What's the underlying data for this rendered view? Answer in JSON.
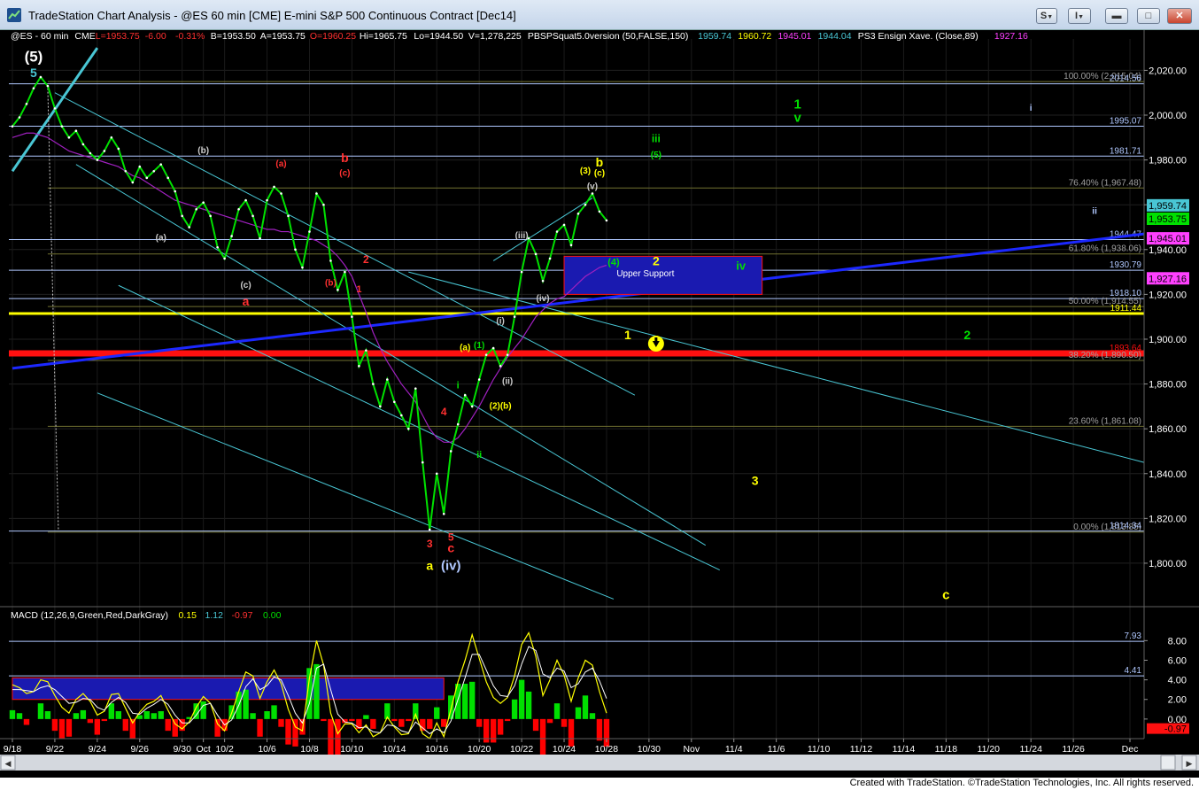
{
  "window": {
    "title": "TradeStation Chart Analysis - @ES 60 min [CME] E-mini S&P 500 Continuous Contract [Dec14]",
    "buttons": {
      "s": "S",
      "i": "I"
    }
  },
  "colors": {
    "price": "#00e000",
    "ma": "#a020c0",
    "channel": "#49c6d4",
    "trend": "#1c28ff",
    "support_line": "#ffff00",
    "resistance_line": "#ff1010",
    "level": "#b0c8ff",
    "fib": "#707030",
    "box": "#1a1ab0",
    "macd_hist_pos": "#00e000",
    "macd_hist_neg": "#ff0000"
  },
  "header": [
    {
      "text": "@ES - 60 min",
      "color": "#ffffff"
    },
    {
      "text": "CME",
      "color": "#ffffff"
    },
    {
      "text": "L=1953.75",
      "color": "#ff3030"
    },
    {
      "text": "-6.00",
      "color": "#ff3030"
    },
    {
      "text": "-0.31%",
      "color": "#ff3030"
    },
    {
      "text": "B=1953.50",
      "color": "#ffffff"
    },
    {
      "text": "A=1953.75",
      "color": "#ffffff"
    },
    {
      "text": "O=1960.25",
      "color": "#ff3030"
    },
    {
      "text": "Hi=1965.75",
      "color": "#ffffff"
    },
    {
      "text": "Lo=1944.50",
      "color": "#ffffff"
    },
    {
      "text": "V=1,278,225",
      "color": "#ffffff"
    },
    {
      "text": "PBSPSquat5.0version (50,FALSE,150)",
      "color": "#ffffff"
    },
    {
      "text": "1959.74",
      "color": "#49c6d4"
    },
    {
      "text": "1960.72",
      "color": "#ffff00"
    },
    {
      "text": "1945.01",
      "color": "#ff40ff"
    },
    {
      "text": "1944.04",
      "color": "#49c6d4"
    },
    {
      "text": "PS3 Ensign Xave. (Close,89)",
      "color": "#ffffff"
    },
    {
      "text": "1927.16",
      "color": "#ff40ff"
    }
  ],
  "chart_data": {
    "type": "line",
    "title": "@ES - 60 min",
    "y_ticks": [
      "2,020.00",
      "2,000.00",
      "1,980.00",
      "1,960.00",
      "1,940.00",
      "1,920.00",
      "1,900.00",
      "1,880.00",
      "1,860.00",
      "1,840.00",
      "1,820.00",
      "1,800.00"
    ],
    "y_tick_values": [
      2020,
      2000,
      1980,
      1960,
      1940,
      1920,
      1900,
      1880,
      1860,
      1840,
      1820,
      1800
    ],
    "ylim": [
      1781,
      2034
    ],
    "x_ticks": [
      {
        "label": "9/18",
        "i": 0
      },
      {
        "label": "9/22",
        "i": 6
      },
      {
        "label": "9/24",
        "i": 12
      },
      {
        "label": "9/26",
        "i": 18
      },
      {
        "label": "9/30",
        "i": 24
      },
      {
        "label": "Oct",
        "i": 27
      },
      {
        "label": "10/2",
        "i": 30
      },
      {
        "label": "10/6",
        "i": 36
      },
      {
        "label": "10/8",
        "i": 42
      },
      {
        "label": "10/10",
        "i": 48
      },
      {
        "label": "10/14",
        "i": 54
      },
      {
        "label": "10/16",
        "i": 60
      },
      {
        "label": "10/20",
        "i": 66
      },
      {
        "label": "10/22",
        "i": 72
      },
      {
        "label": "10/24",
        "i": 78
      },
      {
        "label": "10/28",
        "i": 84
      },
      {
        "label": "10/30",
        "i": 90
      },
      {
        "label": "Nov",
        "i": 96
      },
      {
        "label": "11/4",
        "i": 102
      },
      {
        "label": "11/6",
        "i": 108
      },
      {
        "label": "11/10",
        "i": 114
      },
      {
        "label": "11/12",
        "i": 120
      },
      {
        "label": "11/14",
        "i": 126
      },
      {
        "label": "11/18",
        "i": 132
      },
      {
        "label": "11/20",
        "i": 138
      },
      {
        "label": "11/24",
        "i": 144
      },
      {
        "label": "11/26",
        "i": 150
      },
      {
        "label": "Dec",
        "i": 158
      }
    ],
    "x_range": [
      -0.5,
      160
    ],
    "series": [
      {
        "values": [
          1995,
          1999,
          2005,
          2012,
          2017,
          2013,
          2003,
          1995,
          1990,
          1993,
          1987,
          1983,
          1980,
          1984,
          1990,
          1985,
          1975,
          1970,
          1977,
          1972,
          1975,
          1978,
          1972,
          1966,
          1955,
          1950,
          1958,
          1961,
          1955,
          1941,
          1936,
          1946,
          1958,
          1962,
          1955,
          1945,
          1962,
          1968,
          1965,
          1955,
          1940,
          1932,
          1948,
          1965,
          1960,
          1935,
          1922,
          1930,
          1910,
          1888,
          1895,
          1880,
          1870,
          1882,
          1872,
          1866,
          1860,
          1878,
          1845,
          1815,
          1840,
          1822,
          1850,
          1862,
          1875,
          1870,
          1882,
          1893,
          1896,
          1888,
          1893,
          1910,
          1930,
          1945,
          1938,
          1926,
          1936,
          1948,
          1951,
          1942,
          1956,
          1960,
          1965,
          1957,
          1953
        ],
        "x_start": 0
      }
    ],
    "ma_values": [
      1990,
      1991,
      1992,
      1992,
      1991,
      1990,
      1988,
      1986,
      1984,
      1983,
      1982,
      1981,
      1980,
      1979,
      1978,
      1977,
      1975,
      1973,
      1972,
      1970,
      1968,
      1966,
      1964,
      1962,
      1961,
      1960,
      1959,
      1958,
      1957,
      1956,
      1955,
      1954,
      1953,
      1952,
      1951,
      1950,
      1949,
      1949,
      1948,
      1948,
      1947,
      1946,
      1945,
      1944,
      1942,
      1940,
      1937,
      1933,
      1928,
      1920,
      1912,
      1903,
      1896,
      1890,
      1885,
      1880,
      1876,
      1872,
      1866,
      1860,
      1856,
      1854,
      1854,
      1856,
      1860,
      1865,
      1870,
      1876,
      1882,
      1887,
      1892,
      1896,
      1900,
      1905,
      1910,
      1913,
      1916,
      1918,
      1919,
      1922,
      1925,
      1928,
      1930,
      1932,
      1933
    ],
    "levels": [
      {
        "label": "100.00% (2,015.04)",
        "value": 2015.0,
        "kind": "fib"
      },
      {
        "label": "2014.56",
        "value": 2014.0,
        "kind": "level"
      },
      {
        "label": "1995.07",
        "value": 1995.07,
        "kind": "level"
      },
      {
        "label": "1981.71",
        "value": 1981.71,
        "kind": "level"
      },
      {
        "label": "76.40% (1,967.48)",
        "value": 1967.48,
        "kind": "fib"
      },
      {
        "label": "1944.47",
        "value": 1944.47,
        "kind": "level"
      },
      {
        "label": "61.80% (1,938.06)",
        "value": 1938.06,
        "kind": "fib"
      },
      {
        "label": "1930.79",
        "value": 1930.79,
        "kind": "level"
      },
      {
        "label": "1918.10",
        "value": 1918.1,
        "kind": "level"
      },
      {
        "label": "50.00% (1,914.55)",
        "value": 1914.55,
        "kind": "fib"
      },
      {
        "label": "1911.44",
        "value": 1911.44,
        "kind": "yellow"
      },
      {
        "label": "1893.64",
        "value": 1893.64,
        "kind": "red"
      },
      {
        "label": "38.20% (1,890.50)",
        "value": 1890.5,
        "kind": "fib"
      },
      {
        "label": "23.60% (1,861.08)",
        "value": 1861.08,
        "kind": "fib"
      },
      {
        "label": "0.00% (1,813.85)",
        "value": 1813.85,
        "kind": "fib"
      },
      {
        "label": "1814.34",
        "value": 1814.34,
        "kind": "level"
      }
    ],
    "price_tags": [
      {
        "label": "1,959.74",
        "value": 1959.74,
        "bg": "#49c6d4",
        "fg": "#000000"
      },
      {
        "label": "1,953.75",
        "value": 1953.75,
        "bg": "#00e000",
        "fg": "#000000"
      },
      {
        "label": "1,945.01",
        "value": 1945.01,
        "bg": "#ff40ff",
        "fg": "#000000"
      },
      {
        "label": "1,927.16",
        "value": 1927.16,
        "bg": "#ff40ff",
        "fg": "#000000"
      }
    ],
    "box": {
      "label": "Upper Support",
      "x0": 78,
      "x1": 106,
      "y0": 1920,
      "y1": 1937
    },
    "annotations": [
      {
        "text": "(5)",
        "i": 3,
        "v": 2024,
        "color": "#ffffff",
        "size": 17
      },
      {
        "text": "5",
        "i": 3,
        "v": 2017,
        "color": "#49c6d4",
        "size": 14
      },
      {
        "text": "(b)",
        "i": 27,
        "v": 1983,
        "color": "#cccccc",
        "size": 10
      },
      {
        "text": "(a)",
        "i": 21,
        "v": 1944,
        "color": "#cccccc",
        "size": 10
      },
      {
        "text": "(c)",
        "i": 33,
        "v": 1923,
        "color": "#cccccc",
        "size": 10
      },
      {
        "text": "a",
        "i": 33,
        "v": 1915,
        "color": "#ff3030",
        "size": 14
      },
      {
        "text": "(a)",
        "i": 38,
        "v": 1977,
        "color": "#ff3030",
        "size": 10
      },
      {
        "text": "b",
        "i": 47,
        "v": 1979,
        "color": "#ff3030",
        "size": 14
      },
      {
        "text": "(c)",
        "i": 47,
        "v": 1973,
        "color": "#ff3030",
        "size": 10
      },
      {
        "text": "(b)",
        "i": 45,
        "v": 1924,
        "color": "#ff3030",
        "size": 10
      },
      {
        "text": "2",
        "i": 50,
        "v": 1934,
        "color": "#ff3030",
        "size": 12
      },
      {
        "text": "1",
        "i": 49,
        "v": 1921,
        "color": "#ff3030",
        "size": 11
      },
      {
        "text": "4",
        "i": 61,
        "v": 1866,
        "color": "#ff3030",
        "size": 12
      },
      {
        "text": "3",
        "i": 59,
        "v": 1807,
        "color": "#ff3030",
        "size": 12
      },
      {
        "text": "5",
        "i": 62,
        "v": 1810,
        "color": "#ff3030",
        "size": 12
      },
      {
        "text": "c",
        "i": 62,
        "v": 1805,
        "color": "#ff3030",
        "size": 14
      },
      {
        "text": "a",
        "i": 59,
        "v": 1797,
        "color": "#ffff00",
        "size": 14
      },
      {
        "text": "(iv)",
        "i": 62,
        "v": 1797,
        "color": "#b0c8ff",
        "size": 15
      },
      {
        "text": "i",
        "i": 63,
        "v": 1878,
        "color": "#00e000",
        "size": 11
      },
      {
        "text": "ii",
        "i": 66,
        "v": 1847,
        "color": "#00e000",
        "size": 11
      },
      {
        "text": "(a)",
        "i": 64,
        "v": 1895,
        "color": "#ffff00",
        "size": 10
      },
      {
        "text": "(1)",
        "i": 66,
        "v": 1896,
        "color": "#00e000",
        "size": 10
      },
      {
        "text": "(2)(b)",
        "i": 69,
        "v": 1869,
        "color": "#ffff00",
        "size": 10
      },
      {
        "text": "(i)",
        "i": 69,
        "v": 1907,
        "color": "#cccccc",
        "size": 10
      },
      {
        "text": "(ii)",
        "i": 70,
        "v": 1880,
        "color": "#cccccc",
        "size": 10
      },
      {
        "text": "(iii)",
        "i": 72,
        "v": 1945,
        "color": "#cccccc",
        "size": 10
      },
      {
        "text": "(iv)",
        "i": 75,
        "v": 1917,
        "color": "#cccccc",
        "size": 10
      },
      {
        "text": "(3)",
        "i": 81,
        "v": 1974,
        "color": "#ffff00",
        "size": 10
      },
      {
        "text": "b",
        "i": 83,
        "v": 1977,
        "color": "#ffff00",
        "size": 14
      },
      {
        "text": "(c)",
        "i": 83,
        "v": 1973,
        "color": "#ffff00",
        "size": 10
      },
      {
        "text": "(v)",
        "i": 82,
        "v": 1967,
        "color": "#cccccc",
        "size": 10
      },
      {
        "text": "(4)",
        "i": 85,
        "v": 1933,
        "color": "#00e000",
        "size": 11
      },
      {
        "text": "2",
        "i": 91,
        "v": 1933,
        "color": "#ffff00",
        "size": 14
      },
      {
        "text": "iv",
        "i": 103,
        "v": 1931,
        "color": "#00e000",
        "size": 13
      },
      {
        "text": "iii",
        "i": 91,
        "v": 1988,
        "color": "#00e000",
        "size": 12
      },
      {
        "text": "(5)",
        "i": 91,
        "v": 1981,
        "color": "#00e000",
        "size": 10
      },
      {
        "text": "1",
        "i": 111,
        "v": 2003,
        "color": "#00e000",
        "size": 15
      },
      {
        "text": "v",
        "i": 111,
        "v": 1997,
        "color": "#00e000",
        "size": 15
      },
      {
        "text": "i",
        "i": 144,
        "v": 2002,
        "color": "#b0c8ff",
        "size": 10
      },
      {
        "text": "ii",
        "i": 153,
        "v": 1956,
        "color": "#b0c8ff",
        "size": 10
      },
      {
        "text": "1",
        "i": 87,
        "v": 1900,
        "color": "#ffff00",
        "size": 14
      },
      {
        "text": "2",
        "i": 135,
        "v": 1900,
        "color": "#00e000",
        "size": 14
      },
      {
        "text": "3",
        "i": 105,
        "v": 1835,
        "color": "#ffff00",
        "size": 14
      },
      {
        "text": "c",
        "i": 132,
        "v": 1784,
        "color": "#ffff00",
        "size": 15
      }
    ],
    "macd": {
      "legend": [
        {
          "text": "MACD (12,26,9,Green,Red,DarkGray)",
          "color": "#ffffff"
        },
        {
          "text": "0.15",
          "color": "#ffff00"
        },
        {
          "text": "1.12",
          "color": "#49c6d4"
        },
        {
          "text": "-0.97",
          "color": "#ff3030"
        },
        {
          "text": "0.00",
          "color": "#00e000"
        }
      ],
      "y_ticks": [
        "8.00",
        "6.00",
        "4.00",
        "2.00",
        "0.00"
      ],
      "y_tick_values": [
        8,
        6,
        4,
        2,
        0
      ],
      "ylim": [
        -2,
        10.2
      ],
      "levels": [
        {
          "label": "7.93",
          "value": 7.93
        },
        {
          "label": "4.41",
          "value": 4.41
        }
      ],
      "last_tag": {
        "label": "-0.97",
        "value": -0.97
      },
      "macd_line": [
        3.5,
        3.2,
        2.6,
        2.8,
        4.0,
        3.8,
        2.4,
        1.2,
        0.6,
        2.0,
        2.6,
        1.8,
        0.4,
        0.8,
        2.5,
        2.6,
        1.1,
        -0.4,
        0.7,
        1.5,
        1.8,
        2.4,
        0.9,
        -0.5,
        -1.0,
        -0.3,
        1.2,
        2.3,
        1.6,
        -0.5,
        -1.2,
        0.6,
        2.8,
        4.8,
        4.4,
        2.1,
        3.8,
        5.0,
        3.6,
        1.0,
        -0.8,
        -1.2,
        4.2,
        8.0,
        5.5,
        0.6,
        -1.5,
        -0.5,
        -0.5,
        -1.4,
        -0.6,
        -1.8,
        -1.4,
        0.2,
        -0.8,
        -1.6,
        -1.5,
        0.5,
        -1.5,
        -2.0,
        -0.4,
        -1.8,
        1.0,
        3.8,
        6.0,
        8.6,
        6.2,
        3.8,
        2.2,
        1.6,
        2.2,
        4.4,
        7.6,
        8.8,
        6.4,
        2.4,
        4.0,
        6.0,
        4.5,
        1.8,
        4.2,
        6.0,
        5.5,
        2.8,
        0.6
      ],
      "signal_line": [
        3.0,
        3.0,
        2.9,
        2.8,
        3.2,
        3.4,
        3.0,
        2.3,
        1.6,
        1.7,
        2.1,
        2.0,
        1.2,
        0.9,
        1.7,
        2.2,
        1.7,
        0.6,
        0.5,
        1.1,
        1.5,
        2.0,
        1.5,
        0.4,
        -0.4,
        -0.4,
        0.4,
        1.4,
        1.6,
        0.4,
        -0.6,
        -0.1,
        1.4,
        3.3,
        4.1,
        3.0,
        3.4,
        4.3,
        4.0,
        2.4,
        0.6,
        -0.4,
        1.6,
        5.2,
        5.6,
        3.0,
        0.5,
        -0.3,
        -0.4,
        -0.9,
        -0.8,
        -1.3,
        -1.4,
        -0.6,
        -0.7,
        -1.2,
        -1.4,
        -0.3,
        -0.9,
        -1.5,
        -1.0,
        -1.4,
        -0.2,
        2.0,
        4.2,
        6.6,
        6.6,
        5.0,
        3.4,
        2.4,
        2.3,
        3.4,
        5.6,
        7.4,
        7.0,
        4.6,
        4.2,
        5.2,
        4.9,
        3.2,
        3.6,
        4.8,
        5.2,
        3.9,
        2.1
      ],
      "hist": [
        0.9,
        0.6,
        -0.6,
        0.0,
        1.6,
        0.8,
        -1.2,
        -2.0,
        -1.8,
        0.6,
        0.9,
        -0.4,
        -1.6,
        -0.2,
        1.6,
        0.8,
        -1.2,
        -2.0,
        0.4,
        0.8,
        0.6,
        0.8,
        -1.2,
        -1.8,
        -1.2,
        0.2,
        1.6,
        1.8,
        0.0,
        -1.8,
        -1.2,
        1.4,
        2.8,
        3.0,
        0.6,
        -1.8,
        0.8,
        1.4,
        -0.8,
        -2.6,
        -2.8,
        -1.6,
        5.2,
        5.6,
        -0.2,
        -4.8,
        -4.0,
        -0.4,
        -0.2,
        -1.0,
        0.4,
        -1.0,
        0.0,
        1.6,
        -0.2,
        -0.8,
        -0.2,
        1.6,
        -1.2,
        -1.0,
        1.2,
        -0.8,
        2.4,
        3.6,
        3.6,
        3.8,
        -0.8,
        -2.4,
        -2.4,
        -1.6,
        -0.2,
        2.0,
        4.0,
        2.8,
        -1.2,
        -4.4,
        -0.4,
        1.6,
        -0.8,
        -2.8,
        1.2,
        2.4,
        0.6,
        -2.2,
        -2.8
      ],
      "box": {
        "x0": 0,
        "x1": 61,
        "y0": 2.0,
        "y1": 4.2
      }
    }
  },
  "scrollbar": {
    "left_arrow": "◀",
    "right_arrow": "▶"
  },
  "footer": {
    "text": "Created with TradeStation. ©TradeStation Technologies, Inc. All rights reserved."
  }
}
